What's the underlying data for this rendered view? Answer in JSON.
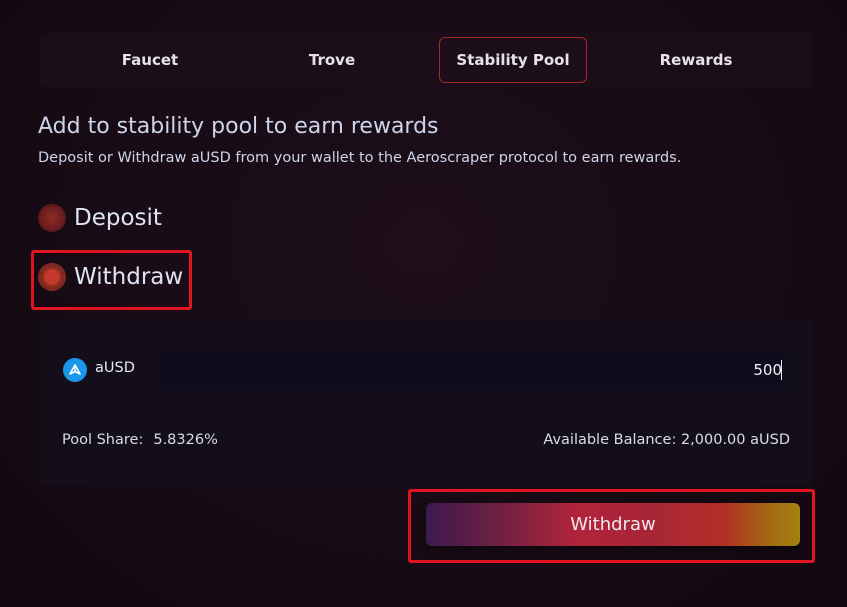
{
  "tabs": [
    {
      "label": "Faucet",
      "active": false
    },
    {
      "label": "Trove",
      "active": false
    },
    {
      "label": "Stability Pool",
      "active": true
    },
    {
      "label": "Rewards",
      "active": false
    }
  ],
  "header": {
    "title": "Add to stability pool to earn rewards",
    "subtitle": "Deposit or Withdraw aUSD from your wallet to the Aeroscraper protocol to earn rewards."
  },
  "options": {
    "deposit_label": "Deposit",
    "withdraw_label": "Withdraw",
    "selected": "Withdraw"
  },
  "panel": {
    "token_icon": "ausd-token-icon",
    "token_name": "aUSD",
    "amount_value": "500",
    "pool_share_label": "Pool Share:",
    "pool_share_value": "5.8326%",
    "available_balance": "Available Balance: 2,000.00 aUSD"
  },
  "action": {
    "button_label": "Withdraw"
  },
  "colors": {
    "background": "#170c15",
    "accent_red": "#e0151f",
    "tab_border": "#a5262b",
    "token_blue": "#1b96ea"
  }
}
